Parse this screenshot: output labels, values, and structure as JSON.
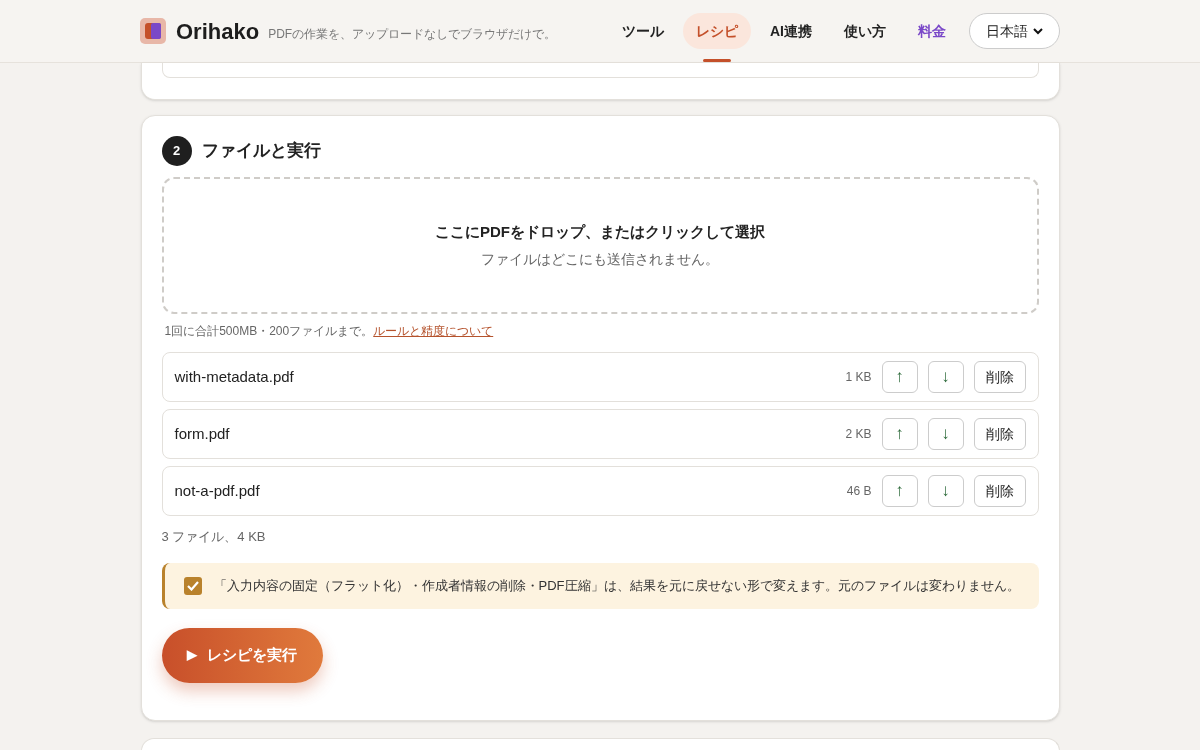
{
  "header": {
    "brand": "Orihako",
    "tagline": "PDFの作業を、アップロードなしでブラウザだけで。",
    "nav": [
      {
        "label": "ツール",
        "selected": false,
        "kind": "plain"
      },
      {
        "label": "レシピ",
        "selected": true,
        "kind": "plain"
      },
      {
        "label": "AI連携",
        "selected": false,
        "kind": "plain"
      },
      {
        "label": "使い方",
        "selected": false,
        "kind": "plain"
      },
      {
        "label": "料金",
        "selected": false,
        "kind": "accent"
      }
    ],
    "language": "日本語"
  },
  "step": {
    "number": "2",
    "title": "ファイルと実行",
    "dropzone": {
      "title": "ここにPDFをドロップ、またはクリックして選択",
      "subtitle": "ファイルはどこにも送信されません。"
    },
    "limit_note": "1回に合計500MB・200ファイルまで。",
    "limit_link": "ルールと精度について",
    "files": [
      {
        "name": "with-metadata.pdf",
        "size": "1 KB",
        "up": "↑",
        "down": "↓",
        "remove": "削除"
      },
      {
        "name": "form.pdf",
        "size": "2 KB",
        "up": "↑",
        "down": "↓",
        "remove": "削除"
      },
      {
        "name": "not-a-pdf.pdf",
        "size": "46 B",
        "up": "↑",
        "down": "↓",
        "remove": "削除"
      }
    ],
    "summary": "3 ファイル、4 KB",
    "warning": {
      "checked": true,
      "text": "「入力内容の固定（フラット化）・作成者情報の削除・PDF圧縮」は、結果を元に戻せない形で変えます。元のファイルは変わりません。"
    },
    "run_button": {
      "icon": "▶",
      "label": "レシピを実行"
    }
  }
}
